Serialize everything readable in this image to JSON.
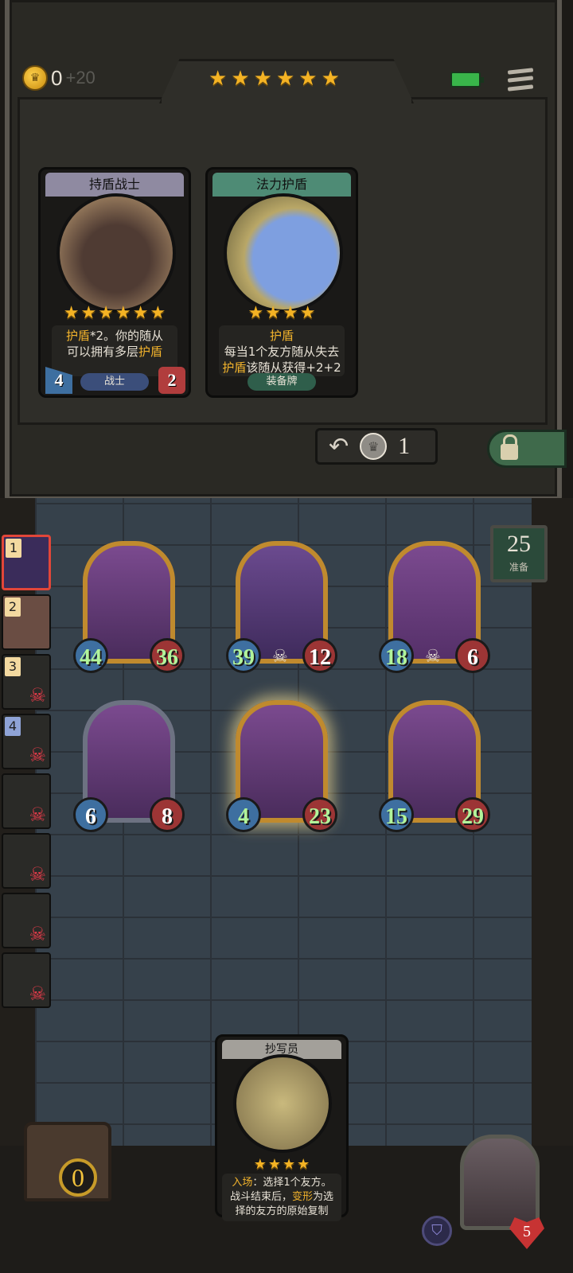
{
  "header": {
    "gold": "0",
    "gold_income": "+20",
    "tier_stars": 6
  },
  "shop": {
    "cards": [
      {
        "title": "持盾战士",
        "stars": 6,
        "text_parts": [
          "护盾",
          "*2。你的随从",
          "可以拥有多层",
          "护盾"
        ],
        "tag": "战士",
        "attack": "4",
        "health": "2",
        "colors": {
          "header": "#8f8aa1",
          "tag": "#3b4e7a"
        }
      },
      {
        "title": "法力护盾",
        "stars": 4,
        "text_parts": [
          "护盾",
          "每当1个友方随从失去",
          "护盾",
          "该随从获得+2+2"
        ],
        "tag": "装备牌",
        "colors": {
          "header": "#4e8b75",
          "tag": "#2f5e4b"
        }
      }
    ],
    "refresh_cost": "1"
  },
  "turn": {
    "number": "25",
    "label": "准备"
  },
  "opponents": [
    {
      "rank": "1",
      "eliminated": false,
      "active": true
    },
    {
      "rank": "2",
      "eliminated": false,
      "active": false
    },
    {
      "rank": "3",
      "eliminated": true,
      "active": false
    },
    {
      "rank": "4",
      "eliminated": true,
      "active": false
    },
    {
      "rank": "",
      "eliminated": true,
      "active": false
    },
    {
      "rank": "",
      "eliminated": true,
      "active": false
    },
    {
      "rank": "",
      "eliminated": true,
      "active": false
    },
    {
      "rank": "",
      "eliminated": true,
      "active": false
    }
  ],
  "board": {
    "minions": [
      {
        "attack": "44",
        "health": "36",
        "frame": "gold",
        "skull": false
      },
      {
        "attack": "39",
        "health": "12",
        "frame": "gold",
        "skull": true
      },
      {
        "attack": "18",
        "health": "6",
        "frame": "gold",
        "skull": true
      },
      {
        "attack": "6",
        "health": "8",
        "frame": "silver",
        "skull": false
      },
      {
        "attack": "4",
        "health": "23",
        "frame": "gold",
        "skull": false,
        "selected": true
      },
      {
        "attack": "15",
        "health": "29",
        "frame": "gold",
        "skull": false
      }
    ]
  },
  "hand": {
    "title": "抄写员",
    "stars": 4,
    "text_parts": [
      "入场",
      "：选择1个友方。",
      "战斗结束后，",
      "变形",
      "为选",
      "择的友方的原始复制"
    ]
  },
  "footer": {
    "chest_count": "0",
    "hero_health": "5"
  }
}
